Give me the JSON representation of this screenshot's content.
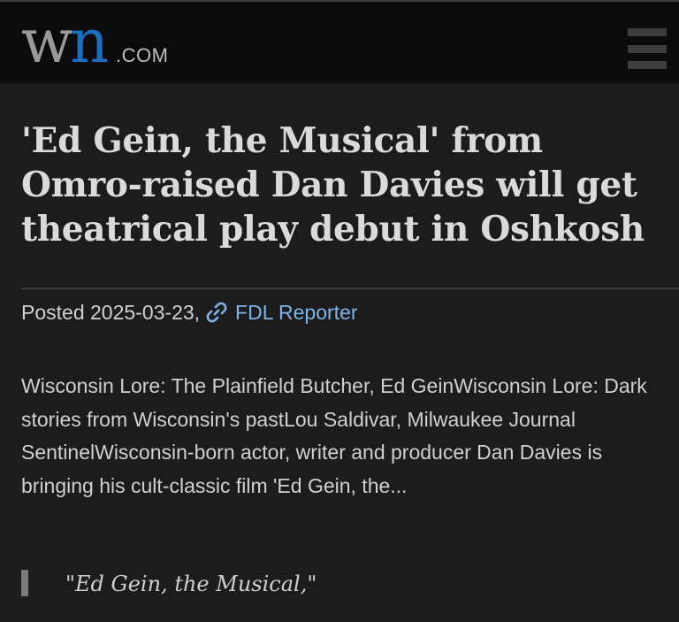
{
  "header": {
    "logo_w": "w",
    "logo_n": "n",
    "logo_domain": ".COM",
    "menu_icon": "hamburger-menu-icon"
  },
  "article": {
    "title_lines": [
      "'Ed Gein, the Musical' from",
      "Omro-raised Dan Davies will get",
      "theatrical play debut in Oshkosh"
    ],
    "posted_label": "Posted 2025-03-23,",
    "source_icon": "link-icon",
    "source": "FDL Reporter",
    "summary": "Wisconsin Lore: The Plainfield Butcher, Ed GeinWisconsin Lore: Dark stories from Wisconsin's pastLou Saldivar, Milwaukee Journal SentinelWisconsin-born actor, writer and producer Dan Davies is bringing his cult-classic film 'Ed Gein, the...",
    "quote": "\"Ed Gein, the Musical,\""
  },
  "colors": {
    "background": "#1c1c1c",
    "header_bg": "#0b0b0b",
    "logo_blue": "#1b6ec2",
    "link_blue": "#7db3e8",
    "text": "#d0d0d0"
  }
}
